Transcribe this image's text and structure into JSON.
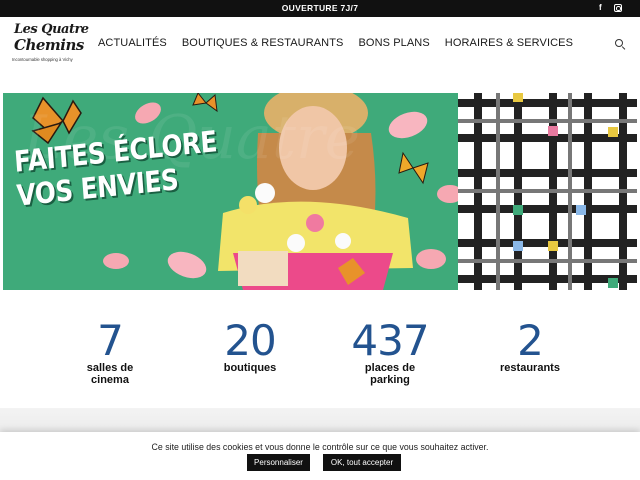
{
  "topbar": {
    "announcement": "OUVERTURE 7J/7",
    "facebook": "f",
    "instagram": ""
  },
  "logo": {
    "line1": "Les Quatre",
    "line2": "Chemins",
    "tagline": "Incontournable shopping à Vichy"
  },
  "nav": {
    "items": [
      "ACTUALITÉS",
      "BOUTIQUES & RESTAURANTS",
      "BONS PLANS",
      "HORAIRES & SERVICES"
    ]
  },
  "banner": {
    "line1": "FAITES ÉCLORE",
    "line2": "VOS ENVIES"
  },
  "stats": [
    {
      "value": "7",
      "label1": "salles de",
      "label2": "cinema"
    },
    {
      "value": "20",
      "label1": "boutiques",
      "label2": ""
    },
    {
      "value": "437",
      "label1": "places de",
      "label2": "parking"
    },
    {
      "value": "2",
      "label1": "restaurants",
      "label2": ""
    }
  ],
  "cookie": {
    "message": "Ce site utilise des cookies et vous donne le contrôle sur ce que vous souhaitez activer.",
    "customize": "Personnaliser",
    "accept": "OK, tout accepter"
  },
  "colors": {
    "banner_green": "#3faa7a",
    "stat_blue": "#23538f",
    "topbar": "#111111"
  }
}
